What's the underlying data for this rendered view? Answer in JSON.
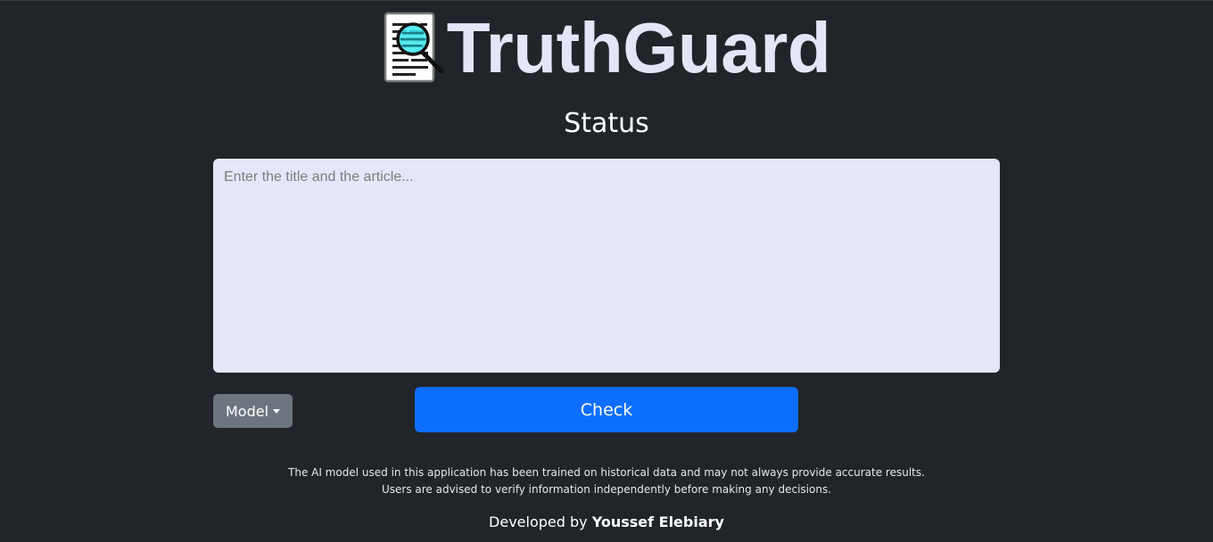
{
  "brand": {
    "title": "TruthGuard",
    "logo_icon": "document-magnifier-icon"
  },
  "status": {
    "label": "Status"
  },
  "article": {
    "placeholder": "Enter the title and the article...",
    "value": ""
  },
  "controls": {
    "model_label": "Model",
    "check_label": "Check"
  },
  "disclaimer": {
    "line1": "The AI model used in this application has been trained on historical data and may not always provide accurate results.",
    "line2": "Users are advised to verify information independently before making any decisions."
  },
  "footer": {
    "prefix": "Developed by",
    "author": "Youssef Elebiary"
  },
  "colors": {
    "background": "#212529",
    "input_background": "#e6e6fa",
    "primary_button": "#0d6efd",
    "secondary_button": "#6c757d",
    "title_color": "#e4e5f7"
  }
}
